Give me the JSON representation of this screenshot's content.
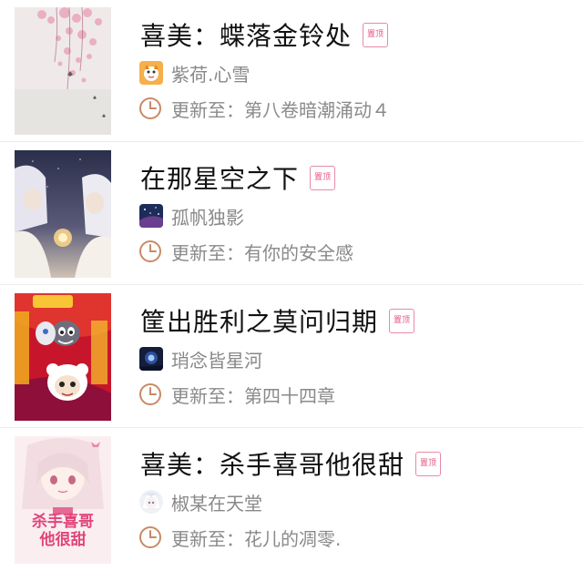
{
  "books": [
    {
      "title": "喜美：蝶落金铃处",
      "badge": "置顶",
      "author": "紫荷.心雪",
      "update_prefix": "更新至：",
      "update_chapter": "第八卷暗潮涌动４",
      "cover_icon": "pink-blossom-cover",
      "avatar_icon": "orange-cartoon-avatar"
    },
    {
      "title": "在那星空之下",
      "badge": "置顶",
      "author": "孤帆独影",
      "update_prefix": "更新至：",
      "update_chapter": "有你的安全感",
      "cover_icon": "anime-couple-cover",
      "avatar_icon": "starry-sky-avatar"
    },
    {
      "title": "筐出胜利之莫问归期",
      "badge": "置顶",
      "author": "琑念皆星河",
      "update_prefix": "更新至：",
      "update_chapter": "第四十四章",
      "cover_icon": "cartoon-sheep-wolf-cover",
      "avatar_icon": "blue-night-avatar"
    },
    {
      "title": "喜美：杀手喜哥他很甜",
      "badge": "置顶",
      "author": "椒某在天堂",
      "update_prefix": "更新至：",
      "update_chapter": "花儿的凋零.",
      "cover_icon": "anime-girl-cover",
      "cover_text": [
        "杀手喜哥",
        "他很甜"
      ],
      "avatar_icon": "white-anime-avatar"
    }
  ],
  "colors": {
    "title": "#111111",
    "meta": "#888888",
    "badge": "#e2577f",
    "clock": "#c98a66",
    "divider": "#ececec"
  }
}
